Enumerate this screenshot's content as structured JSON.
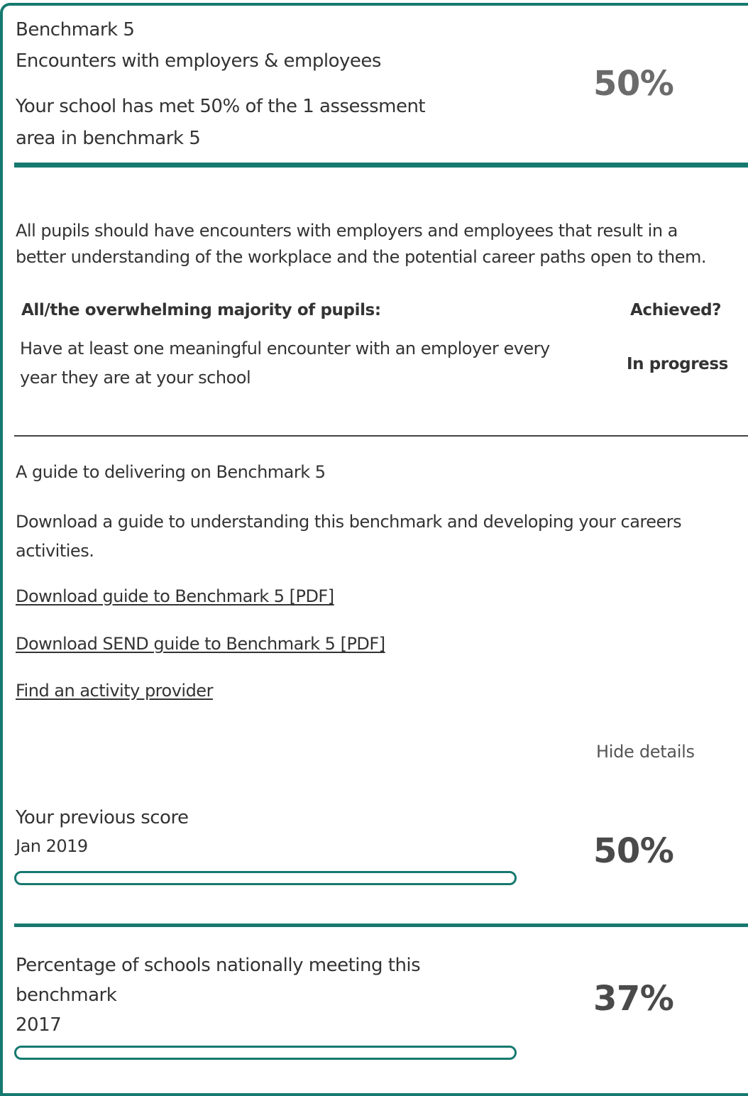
{
  "benchmark": {
    "title": "Benchmark 5",
    "subtitle": "Encounters with employers & employees",
    "summary_line1": "Your school has met 50% of the 1 assessment",
    "summary_line2": "area in benchmark 5",
    "score": "50%",
    "description_line1": "All pupils should have encounters with employers and employees that result in a",
    "description_line2": "better understanding of the workplace and the potential career paths open to them."
  },
  "assessment_table": {
    "header_criterion": "All/the overwhelming majority of pupils:",
    "header_achieved": "Achieved?",
    "rows": [
      {
        "criterion_line1": "Have at least one meaningful encounter with an employer every",
        "criterion_line2": "year they are at your school",
        "status": "In progress"
      }
    ]
  },
  "guide": {
    "heading": "A guide to delivering on Benchmark 5",
    "text_line1": "Download a guide to understanding this benchmark and developing your careers",
    "text_line2": "activities.",
    "links": [
      "Download guide to Benchmark 5 [PDF]",
      "Download SEND guide to Benchmark 5 [PDF]",
      "Find an activity provider"
    ],
    "hide_details": "Hide details"
  },
  "previous_score": {
    "label": "Your previous score",
    "date": "Jan 2019",
    "score": "50%",
    "progress_fraction": 0.5
  },
  "national": {
    "label_line1": "Percentage of schools nationally meeting this",
    "label_line2": "benchmark",
    "year": "2017",
    "score": "37%",
    "progress_fraction": 0.37
  },
  "colors": {
    "accent": "#16796f",
    "text": "#333333"
  }
}
